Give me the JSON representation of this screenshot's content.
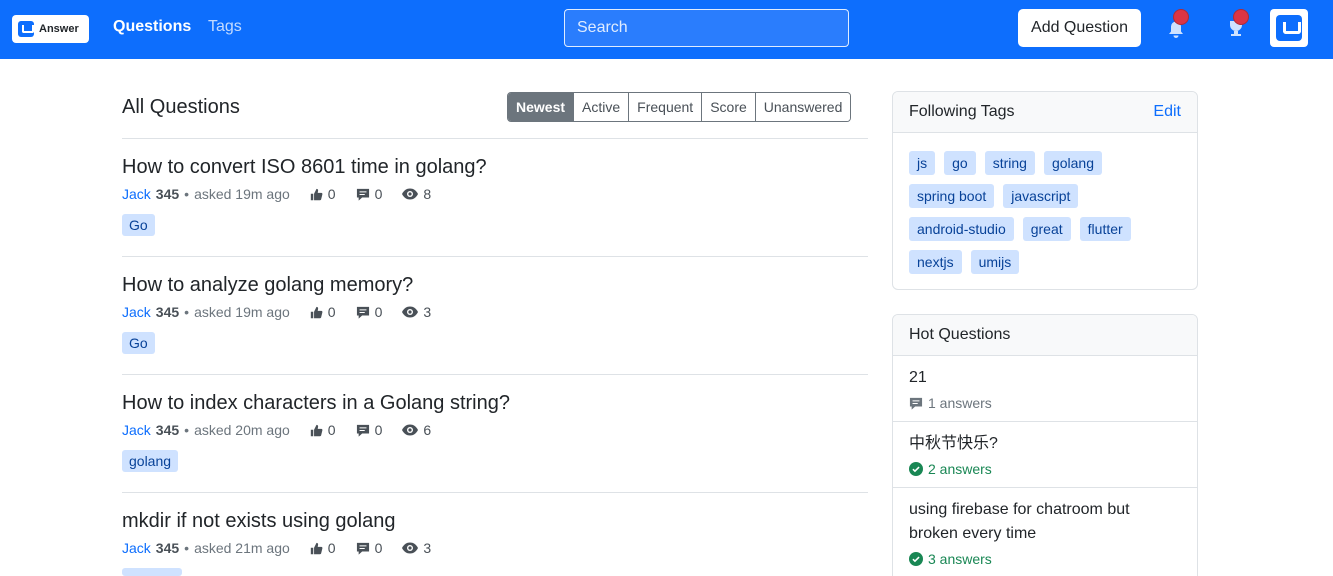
{
  "nav": {
    "logo_text": "Answer",
    "questions_label": "Questions",
    "tags_label": "Tags",
    "search_placeholder": "Search",
    "add_question_label": "Add Question",
    "icons": [
      "bell-icon",
      "trophy-icon",
      "avatar"
    ],
    "accent_color": "#0d6efd"
  },
  "main": {
    "title": "All Questions",
    "filters": [
      "Newest",
      "Active",
      "Frequent",
      "Score",
      "Unanswered"
    ],
    "active_filter": "Newest",
    "questions": [
      {
        "title": "How to convert ISO 8601 time in golang?",
        "author": "Jack",
        "reputation": "345",
        "asked": "asked 19m ago",
        "votes": "0",
        "answers": "0",
        "views": "8",
        "tag": "Go"
      },
      {
        "title": "How to analyze golang memory?",
        "author": "Jack",
        "reputation": "345",
        "asked": "asked 19m ago",
        "votes": "0",
        "answers": "0",
        "views": "3",
        "tag": "Go"
      },
      {
        "title": "How to index characters in a Golang string?",
        "author": "Jack",
        "reputation": "345",
        "asked": "asked 20m ago",
        "votes": "0",
        "answers": "0",
        "views": "6",
        "tag": "golang"
      },
      {
        "title": "mkdir if not exists using golang",
        "author": "Jack",
        "reputation": "345",
        "asked": "asked 21m ago",
        "votes": "0",
        "answers": "0",
        "views": "3",
        "tag": ""
      }
    ]
  },
  "sidebar": {
    "following": {
      "title": "Following Tags",
      "edit_label": "Edit",
      "tags": [
        "js",
        "go",
        "string",
        "golang",
        "spring boot",
        "javascript",
        "android-studio",
        "great",
        "flutter",
        "nextjs",
        "umijs"
      ]
    },
    "hot": {
      "title": "Hot Questions",
      "items": [
        {
          "title": "21",
          "answers": "1 answers",
          "accepted": false
        },
        {
          "title": "中秋节快乐?",
          "answers": "2 answers",
          "accepted": true
        },
        {
          "title": "using firebase for chatroom but broken every time",
          "answers": "3 answers",
          "accepted": true
        }
      ]
    }
  }
}
